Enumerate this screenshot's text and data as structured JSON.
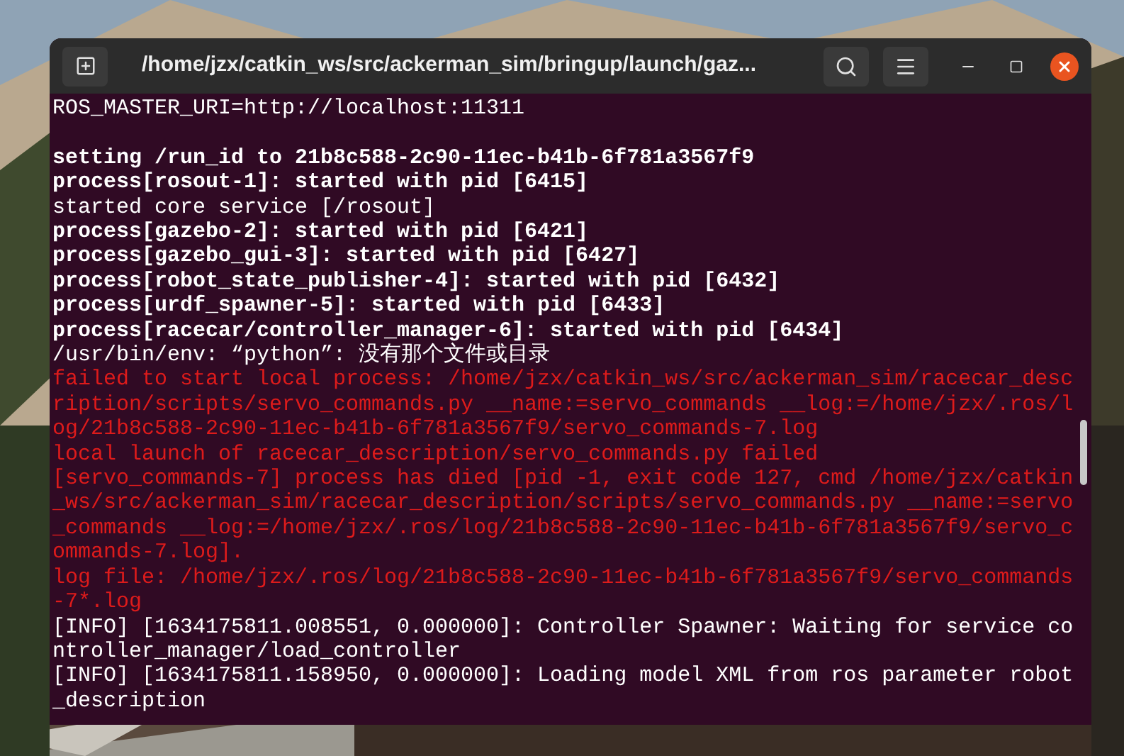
{
  "window": {
    "title": "/home/jzx/catkin_ws/src/ackerman_sim/bringup/launch/gaz..."
  },
  "lines": [
    {
      "kind": "normal",
      "text": "ROS_MASTER_URI=http://localhost:11311"
    },
    {
      "kind": "blank"
    },
    {
      "kind": "bold",
      "text": "setting /run_id to 21b8c588-2c90-11ec-b41b-6f781a3567f9"
    },
    {
      "kind": "bold",
      "text": "process[rosout-1]: started with pid [6415]"
    },
    {
      "kind": "normal",
      "text": "started core service [/rosout]"
    },
    {
      "kind": "bold",
      "text": "process[gazebo-2]: started with pid [6421]"
    },
    {
      "kind": "bold",
      "text": "process[gazebo_gui-3]: started with pid [6427]"
    },
    {
      "kind": "bold",
      "text": "process[robot_state_publisher-4]: started with pid [6432]"
    },
    {
      "kind": "bold",
      "text": "process[urdf_spawner-5]: started with pid [6433]"
    },
    {
      "kind": "bold",
      "text": "process[racecar/controller_manager-6]: started with pid [6434]"
    },
    {
      "kind": "normal",
      "text": "/usr/bin/env: “python”: 没有那个文件或目录"
    },
    {
      "kind": "error",
      "text": "failed to start local process: /home/jzx/catkin_ws/src/ackerman_sim/racecar_desc"
    },
    {
      "kind": "error",
      "text": "ription/scripts/servo_commands.py __name:=servo_commands __log:=/home/jzx/.ros/l"
    },
    {
      "kind": "error",
      "text": "og/21b8c588-2c90-11ec-b41b-6f781a3567f9/servo_commands-7.log"
    },
    {
      "kind": "error",
      "text": "local launch of racecar_description/servo_commands.py failed"
    },
    {
      "kind": "error",
      "text": "[servo_commands-7] process has died [pid -1, exit code 127, cmd /home/jzx/catkin"
    },
    {
      "kind": "error",
      "text": "_ws/src/ackerman_sim/racecar_description/scripts/servo_commands.py __name:=servo"
    },
    {
      "kind": "error",
      "text": "_commands __log:=/home/jzx/.ros/log/21b8c588-2c90-11ec-b41b-6f781a3567f9/servo_c"
    },
    {
      "kind": "error",
      "text": "ommands-7.log]."
    },
    {
      "kind": "error",
      "text": "log file: /home/jzx/.ros/log/21b8c588-2c90-11ec-b41b-6f781a3567f9/servo_commands"
    },
    {
      "kind": "error",
      "text": "-7*.log"
    },
    {
      "kind": "normal",
      "text": "[INFO] [1634175811.008551, 0.000000]: Controller Spawner: Waiting for service co"
    },
    {
      "kind": "normal",
      "text": "ntroller_manager/load_controller"
    },
    {
      "kind": "normal",
      "text": "[INFO] [1634175811.158950, 0.000000]: Loading model XML from ros parameter robot"
    },
    {
      "kind": "normal",
      "text": "_description"
    }
  ]
}
